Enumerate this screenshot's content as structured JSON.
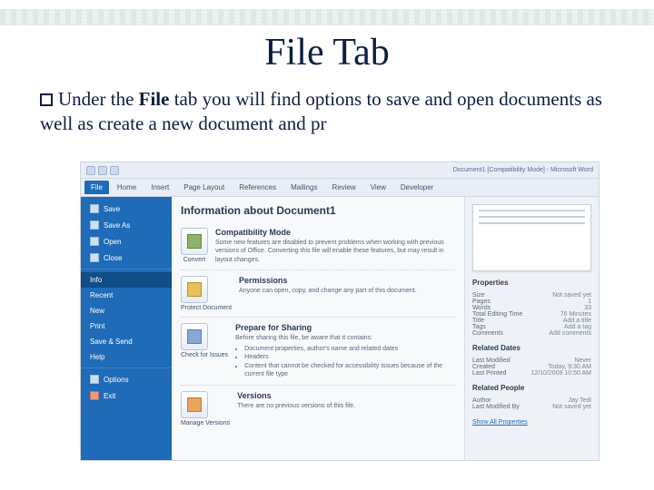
{
  "slide": {
    "title": "File Tab",
    "body_prefix": "Under the ",
    "body_strong": "File",
    "body_rest": " tab you will find options to save and open documents as well as create a new document and pr"
  },
  "word": {
    "doc_title": "Document1 [Compatibility Mode] - Microsoft Word",
    "tabs": [
      "File",
      "Home",
      "Insert",
      "Page Layout",
      "References",
      "Mailings",
      "Review",
      "View",
      "Developer"
    ],
    "side": {
      "save": "Save",
      "save_as": "Save As",
      "open": "Open",
      "close": "Close",
      "info": "Info",
      "recent": "Recent",
      "new": "New",
      "print": "Print",
      "save_send": "Save & Send",
      "help": "Help",
      "options": "Options",
      "exit": "Exit"
    },
    "main": {
      "heading": "Information about Document1",
      "compat": {
        "title": "Compatibility Mode",
        "text": "Some new features are disabled to prevent problems when working with previous versions of Office. Converting this file will enable these features, but may result in layout changes.",
        "btn": "Convert"
      },
      "perm": {
        "title": "Permissions",
        "text": "Anyone can open, copy, and change any part of this document.",
        "btn": "Protect Document"
      },
      "prep": {
        "title": "Prepare for Sharing",
        "lead": "Before sharing this file, be aware that it contains:",
        "items": [
          "Document properties, author's name and related dates",
          "Headers",
          "Content that cannot be checked for accessibility issues because of the current file type"
        ],
        "btn": "Check for Issues"
      },
      "versions": {
        "title": "Versions",
        "text": "There are no previous versions of this file.",
        "btn": "Manage Versions"
      }
    },
    "preview": {
      "props_h": "Properties",
      "props": [
        {
          "k": "Size",
          "v": "Not saved yet"
        },
        {
          "k": "Pages",
          "v": "1"
        },
        {
          "k": "Words",
          "v": "33"
        },
        {
          "k": "Total Editing Time",
          "v": "76 Minutes"
        },
        {
          "k": "Title",
          "v": "Add a title"
        },
        {
          "k": "Tags",
          "v": "Add a tag"
        },
        {
          "k": "Comments",
          "v": "Add comments"
        }
      ],
      "dates_h": "Related Dates",
      "dates": [
        {
          "k": "Last Modified",
          "v": "Never"
        },
        {
          "k": "Created",
          "v": "Today, 9:30 AM"
        },
        {
          "k": "Last Printed",
          "v": "12/10/2009 10:50 AM"
        }
      ],
      "people_h": "Related People",
      "people": [
        {
          "k": "Author",
          "v": "Jay Tedi"
        },
        {
          "k": "Last Modified By",
          "v": "Not saved yet"
        }
      ],
      "show_all": "Show All Properties"
    }
  }
}
